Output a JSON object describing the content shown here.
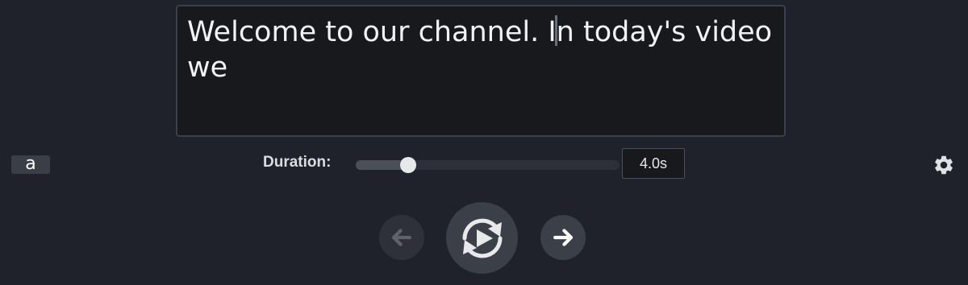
{
  "caption": {
    "text_before_cursor": "Welcome to our channel. I",
    "text_after_cursor": "n today's video we"
  },
  "style_chip": {
    "label": "a"
  },
  "duration": {
    "label": "Duration:",
    "value": "4.0s",
    "slider_level": 0.2
  },
  "controls": {
    "prev_icon": "arrow-left-icon",
    "play_icon": "replay-play-icon",
    "next_icon": "arrow-right-icon",
    "settings_icon": "gear-icon"
  },
  "colors": {
    "background": "#1f222a",
    "editor_background": "#17191c",
    "text": "#f1f2f4",
    "button_active": "#3b3f47",
    "button_disabled": "#2e3139"
  }
}
